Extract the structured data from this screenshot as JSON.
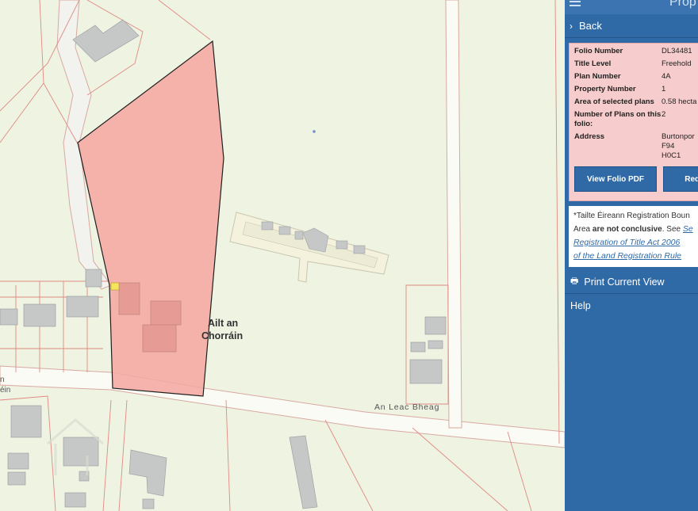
{
  "panel": {
    "title": "Prop",
    "back_label": "Back",
    "fields": [
      {
        "key": "Folio Number",
        "value": "DL34481"
      },
      {
        "key": "Title Level",
        "value": "Freehold"
      },
      {
        "key": "Plan Number",
        "value": "4A"
      },
      {
        "key": "Property Number",
        "value": "1"
      },
      {
        "key": "Area of selected plans",
        "value": "0.58 hecta"
      },
      {
        "key": "Number of Plans on this folio:",
        "value": "2"
      },
      {
        "key": "Address",
        "value": "Burtonpor F94 H0C1"
      }
    ],
    "view_pdf_label": "View Folio PDF",
    "request_label": "Request C",
    "note": {
      "line1": "*Tailte Éireann Registration Boun",
      "line2_pre": "Area ",
      "line2_bold": "are not conclusive",
      "line2_post": ". See ",
      "line2_link": "Se",
      "line3_link": "Registration of Title Act 2006",
      "line4_link": "of the Land Registration Rule"
    },
    "print_label": "Print Current View",
    "help_label": "Help"
  },
  "map": {
    "place_label_line1": "Ailt an",
    "place_label_line2": "Chorráin",
    "road_label": "An Leac Bheag",
    "edge_label_line1": "n",
    "edge_label_line2": "éin"
  },
  "colors": {
    "panel_bg": "#2f6aa6",
    "parcel_fill": "#f4a6a1",
    "map_bg": "#eef3e2"
  }
}
